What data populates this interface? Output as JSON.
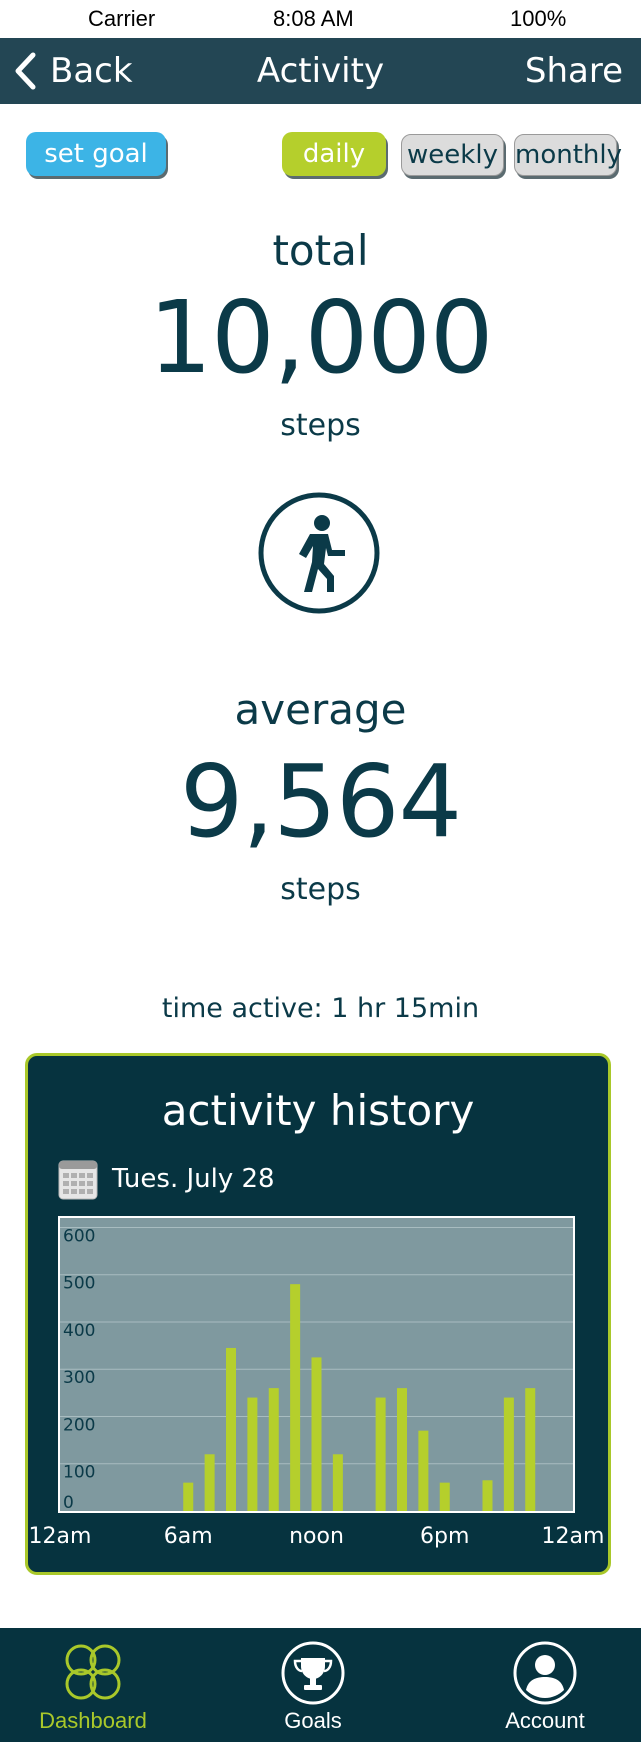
{
  "status_bar": {
    "carrier": "Carrier",
    "time": "8:08 AM",
    "battery": "100%"
  },
  "nav": {
    "back_label": "Back",
    "title": "Activity",
    "share_label": "Share"
  },
  "controls": {
    "set_goal": "set goal",
    "daily": "daily",
    "weekly": "weekly",
    "monthly": "monthly",
    "selected": "daily"
  },
  "total": {
    "label": "total",
    "value": "10,000",
    "unit": "steps"
  },
  "average": {
    "label": "average",
    "value": "9,564",
    "unit": "steps"
  },
  "time_active": "time active: 1 hr 15min",
  "history": {
    "title": "activity history",
    "date": "Tues. July 28"
  },
  "chart_data": {
    "type": "bar",
    "x": [
      6.0,
      7.0,
      8.0,
      9.0,
      10.0,
      11.0,
      12.0,
      13.0,
      15.0,
      16.0,
      17.0,
      18.0,
      20.0,
      21.0,
      22.0
    ],
    "values": [
      60,
      120,
      345,
      240,
      260,
      480,
      325,
      120,
      240,
      260,
      170,
      60,
      65,
      240,
      260
    ],
    "ylim": [
      0,
      620
    ],
    "xlim": [
      0,
      24
    ],
    "yticks": [
      0,
      100,
      200,
      300,
      400,
      500,
      600
    ],
    "xtick_labels": [
      {
        "x": 0,
        "label": "12am"
      },
      {
        "x": 6,
        "label": "6am"
      },
      {
        "x": 12,
        "label": "noon"
      },
      {
        "x": 18,
        "label": "6pm"
      },
      {
        "x": 24,
        "label": "12am"
      }
    ],
    "grid": true,
    "bar_color": "#b5cf2c",
    "plot_bg": "#7f999f"
  },
  "tabs": [
    {
      "label": "Dashboard",
      "icon": "clover-icon",
      "active": true
    },
    {
      "label": "Goals",
      "icon": "trophy-icon",
      "active": false
    },
    {
      "label": "Account",
      "icon": "user-icon",
      "active": false
    }
  ],
  "colors": {
    "navy": "#06333f",
    "nav": "#234654",
    "accent": "#a9c82a",
    "blue": "#3cb4e6"
  }
}
